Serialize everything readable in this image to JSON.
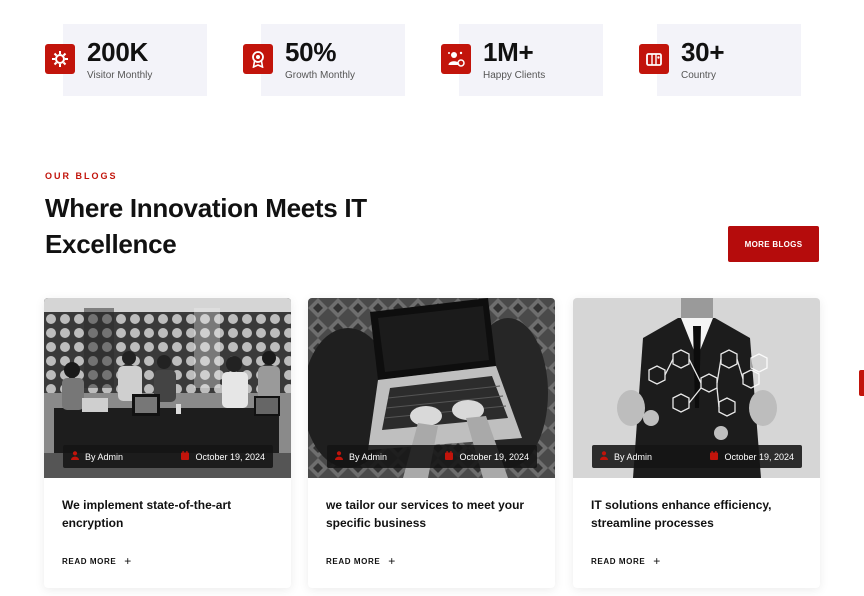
{
  "stats": [
    {
      "value": "200K",
      "label": "Visitor Monthly",
      "icon": "gear-network-icon"
    },
    {
      "value": "50%",
      "label": "Growth Monthly",
      "icon": "award-badge-icon"
    },
    {
      "value": "1M+",
      "label": "Happy Clients",
      "icon": "happy-users-icon"
    },
    {
      "value": "30+",
      "label": "Country",
      "icon": "country-map-icon"
    }
  ],
  "section": {
    "eyebrow": "OUR BLOGS",
    "title": "Where Innovation Meets IT Excellence",
    "cta_label": "MORE BLOGS"
  },
  "cards": [
    {
      "author": "By Admin",
      "date": "October 19, 2024",
      "title": "We implement state-of-the-art encryption",
      "read_more": "READ MORE"
    },
    {
      "author": "By Admin",
      "date": "October 19, 2024",
      "title": "we tailor our services to meet your specific business",
      "read_more": "READ MORE"
    },
    {
      "author": "By Admin",
      "date": "October 19, 2024",
      "title": "IT solutions enhance efficiency, streamline processes",
      "read_more": "READ MORE"
    }
  ],
  "colors": {
    "accent": "#c2140b",
    "stat_bg": "#f3f3f9",
    "meta_bg": "#141414"
  }
}
